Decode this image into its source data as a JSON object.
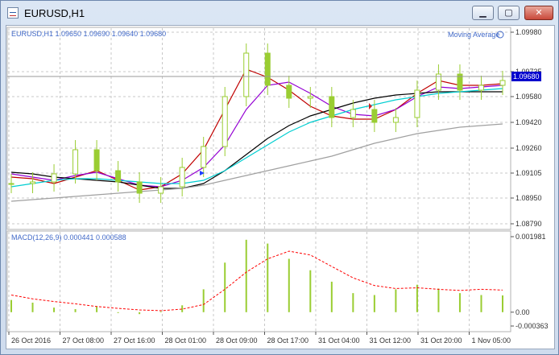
{
  "window": {
    "title": "EURUSD,H1",
    "minimize_label": "▁",
    "maximize_label": "▢",
    "close_label": "✕"
  },
  "main_panel": {
    "header": "EURUSD,H1  1.09650 1.09690 1.09640 1.09680",
    "indicator_label": "Moving Average",
    "price_ticks": [
      "1.09980",
      "1.09735",
      "1.09580",
      "1.09420",
      "1.09260",
      "1.09105",
      "1.08950",
      "1.08790"
    ],
    "current_price_label": "1.09680"
  },
  "macd_panel": {
    "header": "MACD(12,26,9) 0.000441 0.000588",
    "ticks": [
      "0.001981",
      "0.00",
      "-0.000363"
    ]
  },
  "time_axis": {
    "labels": [
      "26 Oct 2016",
      "27 Oct 08:00",
      "27 Oct 16:00",
      "28 Oct 01:00",
      "28 Oct 09:00",
      "28 Oct 17:00",
      "31 Oct 04:00",
      "31 Oct 12:00",
      "31 Oct 20:00",
      "1 Nov 05:00"
    ]
  },
  "colors": {
    "candle": "#9acd32",
    "ma_red": "#c00000",
    "ma_purple": "#9400d3",
    "ma_black": "#000000",
    "ma_cyan": "#00ced1",
    "ma_gray": "#a0a0a0",
    "macd_signal": "#ff0000",
    "axis_text": "#4169c8"
  },
  "chart_data": [
    {
      "type": "candlestick",
      "title": "EURUSD,H1",
      "x": [
        "26 Oct 2016",
        "27 Oct 08:00",
        "27 Oct 16:00",
        "28 Oct 01:00",
        "28 Oct 09:00",
        "28 Oct 17:00",
        "31 Oct 04:00",
        "31 Oct 12:00",
        "31 Oct 20:00",
        "1 Nov 05:00"
      ],
      "ylim": [
        1.0879,
        1.0998
      ],
      "ohlc_last": {
        "open": 1.0965,
        "high": 1.0969,
        "low": 1.0964,
        "close": 1.0968
      },
      "close_approx": [
        1.0904,
        1.0905,
        1.091,
        1.0925,
        1.0912,
        1.0905,
        1.0898,
        1.0902,
        1.0914,
        1.0927,
        1.0958,
        1.0985,
        1.0965,
        1.0957,
        1.0958,
        1.0945,
        1.095,
        1.0942,
        1.0945,
        1.0962,
        1.0972,
        1.0962,
        1.0965,
        1.0968
      ],
      "moving_averages": {
        "red": [
          1.0908,
          1.0907,
          1.0904,
          1.0908,
          1.0912,
          1.0906,
          1.09,
          1.0902,
          1.091,
          1.0925,
          1.095,
          1.0975,
          1.097,
          1.0962,
          1.0952,
          1.0946,
          1.0944,
          1.0944,
          1.095,
          1.096,
          1.0968,
          1.0965,
          1.0965,
          1.0966
        ],
        "purple": [
          1.091,
          1.0908,
          1.0906,
          1.0909,
          1.0911,
          1.0907,
          1.0903,
          1.0902,
          1.0906,
          1.0914,
          1.0928,
          1.095,
          1.0965,
          1.0967,
          1.096,
          1.0952,
          1.0947,
          1.0946,
          1.095,
          1.0958,
          1.0964,
          1.0963,
          1.0964,
          1.0965
        ],
        "black": [
          1.0911,
          1.091,
          1.0908,
          1.0907,
          1.0906,
          1.0905,
          1.0903,
          1.0901,
          1.0901,
          1.0904,
          1.0912,
          1.0922,
          1.0932,
          1.094,
          1.0946,
          1.095,
          1.0954,
          1.0957,
          1.0959,
          1.096,
          1.0961,
          1.0961,
          1.0961,
          1.0961
        ],
        "cyan": [
          1.0902,
          1.0904,
          1.0906,
          1.0907,
          1.0907,
          1.0906,
          1.0905,
          1.0904,
          1.0904,
          1.0906,
          1.0912,
          1.092,
          1.0928,
          1.0936,
          1.0942,
          1.0946,
          1.095,
          1.0953,
          1.0956,
          1.0958,
          1.096,
          1.0961,
          1.0962,
          1.0963
        ],
        "gray": [
          1.0893,
          1.0894,
          1.0895,
          1.0896,
          1.0897,
          1.0898,
          1.0899,
          1.09,
          1.0901,
          1.0903,
          1.0906,
          1.0909,
          1.0912,
          1.0915,
          1.0918,
          1.0921,
          1.0925,
          1.0929,
          1.0932,
          1.0935,
          1.0937,
          1.0939,
          1.094,
          1.0941
        ]
      }
    },
    {
      "type": "bar",
      "title": "MACD(12,26,9) 0.000441 0.000588",
      "ylim": [
        -0.000363,
        0.001981
      ],
      "histogram": [
        0.00032,
        0.00025,
        0.00012,
        8e-05,
        0.00015,
        0.0,
        -5e-05,
        2e-05,
        0.00018,
        0.0006,
        0.0013,
        0.0019,
        0.0018,
        0.0014,
        0.0011,
        0.0008,
        0.0005,
        0.00045,
        0.0006,
        0.00072,
        0.00062,
        0.0005,
        0.00045,
        0.00044
      ],
      "signal": [
        0.00045,
        0.00035,
        0.00028,
        0.00022,
        0.00015,
        0.0001,
        6e-05,
        4e-05,
        8e-05,
        0.0002,
        0.0006,
        0.00105,
        0.0014,
        0.0016,
        0.0015,
        0.0012,
        0.0009,
        0.0007,
        0.00062,
        0.00064,
        0.0006,
        0.00057,
        0.0006,
        0.00058
      ]
    }
  ]
}
